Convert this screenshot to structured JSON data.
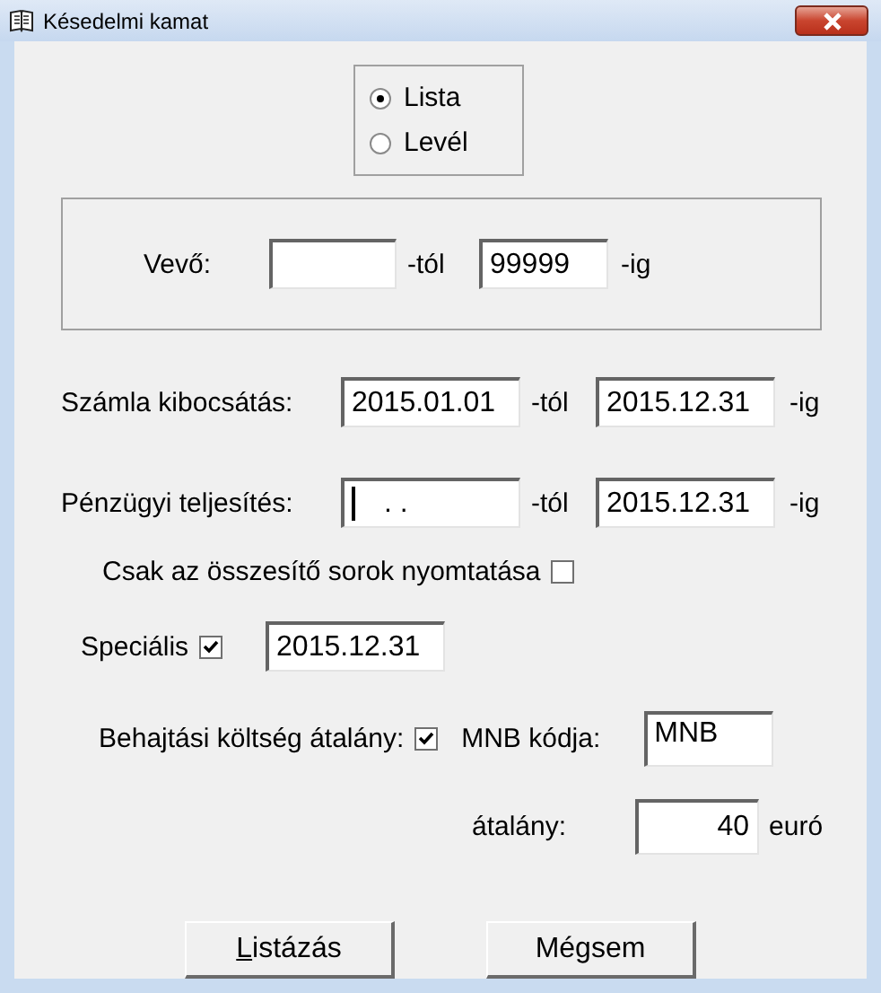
{
  "window": {
    "title": "Késedelmi kamat"
  },
  "output_mode": [
    {
      "label": "Lista",
      "selected": true
    },
    {
      "label": "Levél",
      "selected": false
    }
  ],
  "customer": {
    "label": "Vevő:",
    "from_suffix": "-tól",
    "to": "99999",
    "to_suffix": "-ig"
  },
  "date_ranges": [
    {
      "label": "Számla kibocsátás:",
      "from": "2015.01.01",
      "focused": false,
      "from_suffix": "-tól",
      "to": "2015.12.31",
      "to_suffix": "-ig"
    },
    {
      "label": "Pénzügyi teljesítés:",
      "from": ".  .",
      "focused": true,
      "from_suffix": "-tól",
      "to": "2015.12.31",
      "to_suffix": "-ig"
    }
  ],
  "summary_only": {
    "label": "Csak az összesítő sorok nyomtatása",
    "checked": false
  },
  "special": {
    "label": "Speciális",
    "checked": true,
    "date": "2015.12.31"
  },
  "collection_fee": {
    "label": "Behajtási költség átalány:",
    "checked": true,
    "code_label": "MNB kódja:",
    "code": "MNB",
    "amount_label": "átalány:",
    "amount": "40",
    "unit": "euró"
  },
  "buttons": [
    {
      "label": "Listázás",
      "access_key": true
    },
    {
      "label": "Mégsem",
      "access_key": false
    }
  ]
}
